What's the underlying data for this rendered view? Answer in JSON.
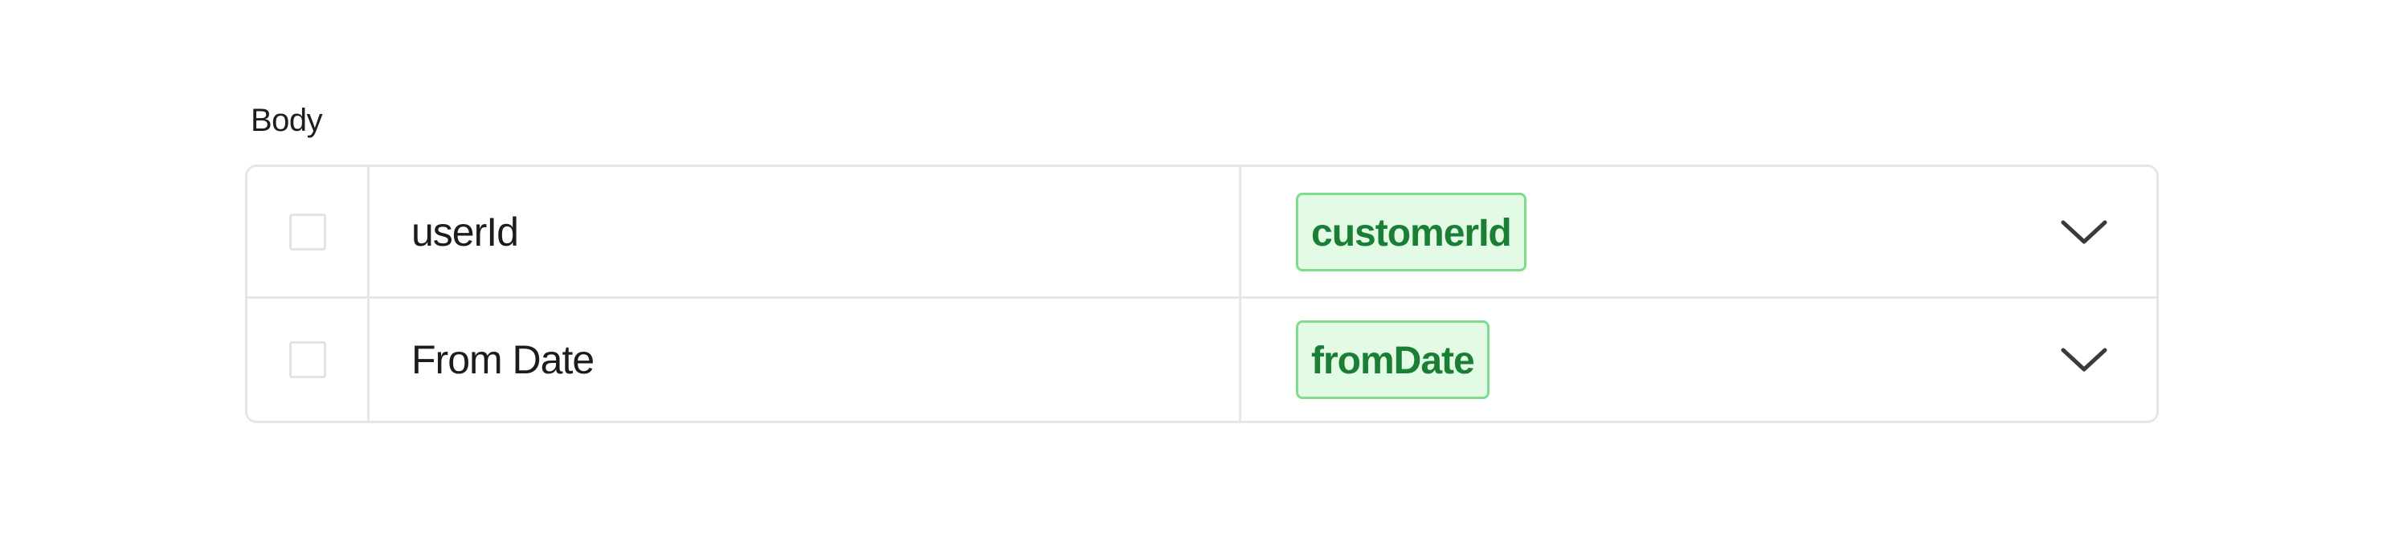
{
  "section": {
    "label": "Body"
  },
  "rows": [
    {
      "name": "userId",
      "value": "customerId",
      "checked": false
    },
    {
      "name": "From Date",
      "value": "fromDate",
      "checked": false
    }
  ],
  "colors": {
    "chip_background": "#e3fbe4",
    "chip_border": "#7fdc8c",
    "chip_text": "#1a7f34",
    "border": "#e6e6e6"
  },
  "icons": {
    "row_toggle": "chevron-down-icon"
  }
}
